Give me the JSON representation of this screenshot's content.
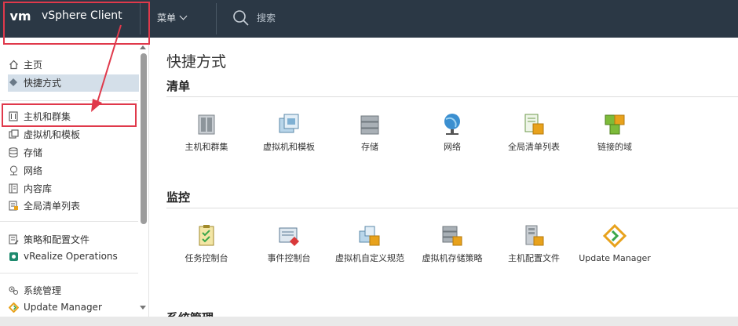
{
  "header": {
    "logo": "vm",
    "app_title": "vSphere Client",
    "menu_label": "菜单",
    "search_label": "搜索"
  },
  "sidebar": {
    "group1": [
      {
        "label": "主页",
        "icon": "home-icon"
      },
      {
        "label": "快捷方式",
        "icon": "shortcuts-icon"
      }
    ],
    "group2": [
      {
        "label": "主机和群集",
        "icon": "host-cluster-icon"
      },
      {
        "label": "虚拟机和模板",
        "icon": "vm-template-icon"
      },
      {
        "label": "存储",
        "icon": "storage-icon"
      },
      {
        "label": "网络",
        "icon": "network-icon"
      },
      {
        "label": "内容库",
        "icon": "content-library-icon"
      },
      {
        "label": "全局清单列表",
        "icon": "global-inventory-icon"
      }
    ],
    "group3": [
      {
        "label": "策略和配置文件",
        "icon": "policy-icon"
      },
      {
        "label": "vRealize Operations",
        "icon": "vrealize-icon"
      }
    ],
    "group4": [
      {
        "label": "系统管理",
        "icon": "admin-icon"
      },
      {
        "label": "Update Manager",
        "icon": "update-manager-icon"
      }
    ]
  },
  "main": {
    "title": "快捷方式",
    "inventory": {
      "title": "清单",
      "tiles": [
        {
          "label": "主机和群集",
          "icon": "host-cluster-icon"
        },
        {
          "label": "虚拟机和模板",
          "icon": "vm-template-icon"
        },
        {
          "label": "存储",
          "icon": "storage-icon"
        },
        {
          "label": "网络",
          "icon": "network-globe-icon"
        },
        {
          "label": "全局清单列表",
          "icon": "global-inventory-icon"
        },
        {
          "label": "链接的域",
          "icon": "linked-domain-icon"
        }
      ]
    },
    "monitoring": {
      "title": "监控",
      "tiles": [
        {
          "label": "任务控制台",
          "icon": "task-console-icon"
        },
        {
          "label": "事件控制台",
          "icon": "event-console-icon"
        },
        {
          "label": "虚拟机自定义规范",
          "icon": "vm-customization-icon"
        },
        {
          "label": "虚拟机存储策略",
          "icon": "vm-storage-policy-icon"
        },
        {
          "label": "主机配置文件",
          "icon": "host-profile-icon"
        },
        {
          "label": "Update Manager",
          "icon": "update-manager-icon"
        }
      ]
    },
    "next_section_title": "系统管理"
  },
  "colors": {
    "header_bg": "#2b3845",
    "highlight": "#e0394b",
    "active_item_bg": "#d4dfe9"
  }
}
